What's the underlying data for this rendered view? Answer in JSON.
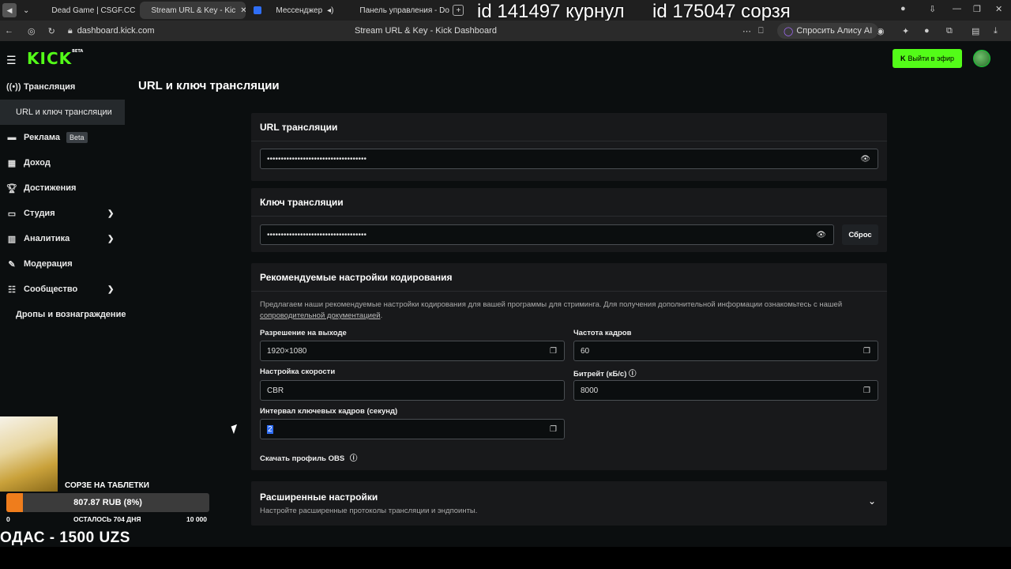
{
  "browser": {
    "tabs": [
      {
        "label": "Dead Game | CSGF.CC",
        "active": false
      },
      {
        "label": "Stream URL & Key - Kic",
        "active": true
      },
      {
        "label": "Мессенджер",
        "active": false
      },
      {
        "label": "Панель управления - Do",
        "active": false
      }
    ],
    "url": "dashboard.kick.com",
    "page_title": "Stream URL & Key - Kick Dashboard",
    "alice_label": "Спросить Алису AI"
  },
  "overlay": {
    "top_left_text": "id 141497 курнул",
    "top_right_text": "id 175047 сорзя",
    "goal_title": "СОРЗЕ НА ТАБЛЕТКИ",
    "goal_progress_text": "807.87 RUB (8%)",
    "goal_fraction": 0.08,
    "goal_min": "0",
    "goal_remaining": "ОСТАЛОСЬ 704 ДНЯ",
    "goal_max": "10 000",
    "bottom_text": "ОДАС - 1500 UZS"
  },
  "app": {
    "logo": "KICK",
    "logo_badge": "BETA",
    "go_live_label": "Выйти в эфир",
    "accent": "#53fc18"
  },
  "sidebar": {
    "items": [
      {
        "label": "Трансляция",
        "icon": "broadcast-icon"
      },
      {
        "label": "URL и ключ трансляции",
        "icon": ""
      },
      {
        "label": "Реклама",
        "icon": "ad-icon",
        "badge": "Beta"
      },
      {
        "label": "Доход",
        "icon": "revenue-icon"
      },
      {
        "label": "Достижения",
        "icon": "trophy-icon"
      },
      {
        "label": "Студия",
        "icon": "studio-icon"
      },
      {
        "label": "Аналитика",
        "icon": "analytics-icon"
      },
      {
        "label": "Модерация",
        "icon": "wrench-icon"
      },
      {
        "label": "Сообщество",
        "icon": "community-icon"
      },
      {
        "label": "Дропы и вознаграждение",
        "icon": ""
      }
    ]
  },
  "main": {
    "title": "URL и ключ трансляции",
    "url_section": {
      "title": "URL трансляции",
      "value": "••••••••••••••••••••••••••••••••••••"
    },
    "key_section": {
      "title": "Ключ трансляции",
      "value": "••••••••••••••••••••••••••••••••••••",
      "reset_label": "Сброс"
    },
    "encoding": {
      "title": "Рекомендуемые настройки кодирования",
      "desc_part1": "Предлагаем наши рекомендуемые настройки кодирования для вашей программы для стриминга. Для получения дополнительной информации ознакомьтесь с нашей",
      "desc_link": "сопроводительной документацией",
      "desc_end": ".",
      "resolution_label": "Разрешение на выходе",
      "resolution_value": "1920×1080",
      "fps_label": "Частота кадров",
      "fps_value": "60",
      "rate_label": "Настройка скорости",
      "rate_value": "CBR",
      "bitrate_label": "Битрейт (кБ/с)",
      "bitrate_value": "8000",
      "keyframe_label": "Интервал ключевых кадров (секунд)",
      "keyframe_value": "2",
      "download_label": "Скачать профиль OBS"
    },
    "advanced": {
      "title": "Расширенные настройки",
      "subtitle": "Настройте расширенные протоколы трансляции и эндпоинты."
    }
  }
}
